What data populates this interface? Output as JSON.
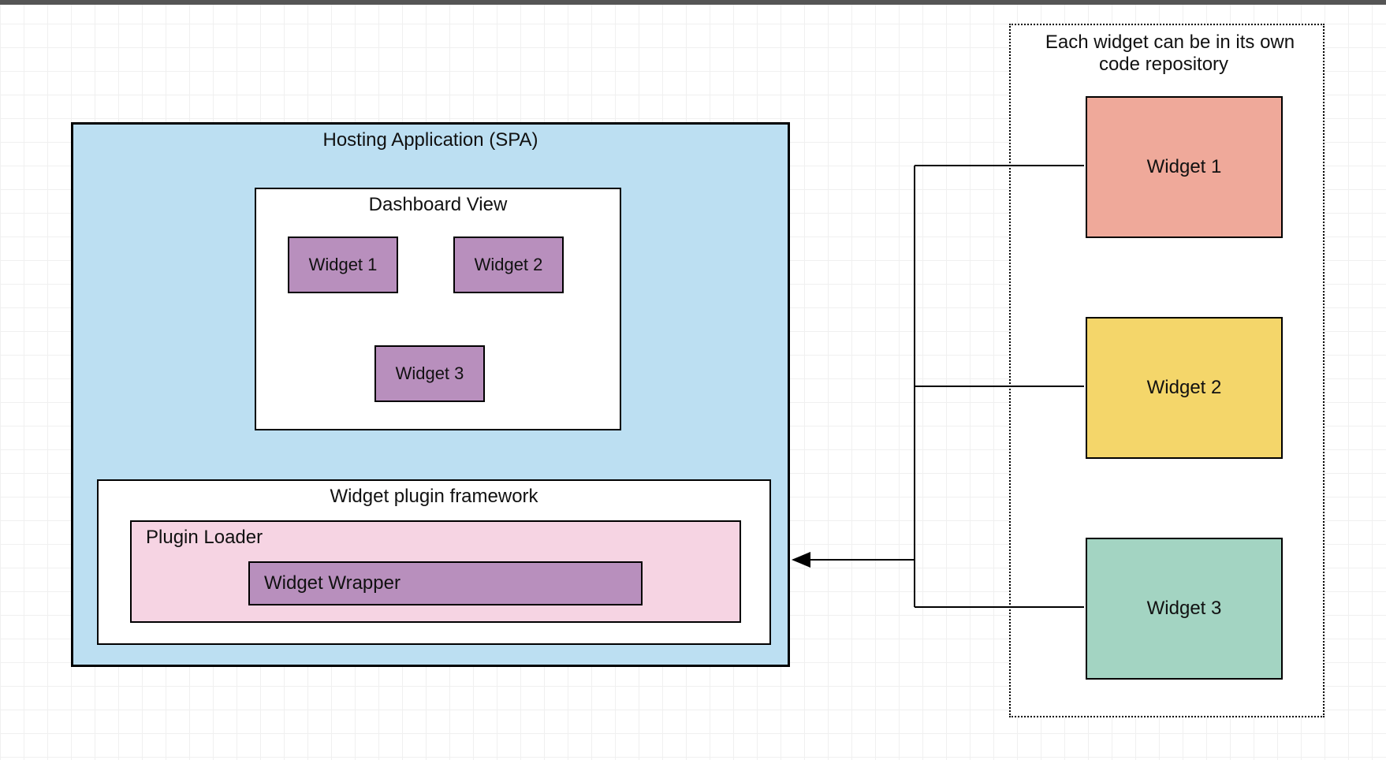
{
  "hosting": {
    "title": "Hosting Application (SPA)"
  },
  "dashboard": {
    "title": "Dashboard View",
    "widgets": [
      "Widget 1",
      "Widget 2",
      "Widget 3"
    ]
  },
  "framework": {
    "title": "Widget plugin framework",
    "loader": "Plugin Loader",
    "wrapper": "Widget Wrapper"
  },
  "repos": {
    "title": "Each widget can be in its own code repository",
    "widgets": [
      "Widget 1",
      "Widget 2",
      "Widget 3"
    ]
  },
  "colors": {
    "hosting": "#bcdff2",
    "widget_mini": "#b88fbd",
    "loader": "#f6d4e3",
    "wrapper": "#b88fbd",
    "repo1": "#efa99a",
    "repo2": "#f4d66a",
    "repo3": "#a3d4c2"
  }
}
